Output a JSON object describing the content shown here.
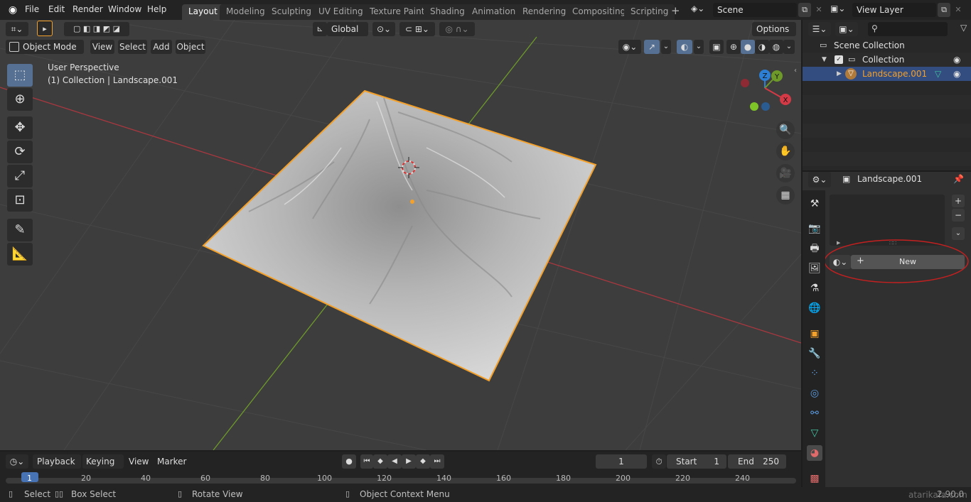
{
  "topbar": {
    "menus": [
      "File",
      "Edit",
      "Render",
      "Window",
      "Help"
    ],
    "workspace_tabs": [
      "Layout",
      "Modeling",
      "Sculpting",
      "UV Editing",
      "Texture Paint",
      "Shading",
      "Animation",
      "Rendering",
      "Compositing",
      "Scripting"
    ],
    "active_tab": "Layout",
    "scene": "Scene",
    "view_layer": "View Layer"
  },
  "viewport_header": {
    "transform_orientation": "Global",
    "options": "Options",
    "mode": "Object Mode",
    "menus": [
      "View",
      "Select",
      "Add",
      "Object"
    ]
  },
  "viewport": {
    "perspective_label": "User Perspective",
    "context_label": "(1) Collection | Landscape.001",
    "gizmo_axes": {
      "x": "X",
      "y": "Y",
      "z": "Z"
    },
    "colors": {
      "background": "#3d3d3d",
      "x_axis": "#a8383f",
      "y_axis": "#6e9a2a",
      "selection_outline": "#f4a12b",
      "terrain": "#c4c4c4"
    }
  },
  "toolbar": {
    "tools": [
      "select-box-icon",
      "cursor-icon",
      "move-icon",
      "rotate-icon",
      "scale-icon",
      "transform-icon",
      "annotate-icon",
      "measure-icon"
    ]
  },
  "outliner": {
    "search_placeholder": "",
    "scene_collection": "Scene Collection",
    "collection": "Collection",
    "object": "Landscape.001"
  },
  "properties": {
    "object_name": "Landscape.001",
    "new_button": "New"
  },
  "timeline": {
    "menus": [
      "Playback",
      "Keying",
      "View",
      "Marker"
    ],
    "current_frame": "1",
    "start_label": "Start",
    "start_value": "1",
    "end_label": "End",
    "end_value": "250",
    "ticks": [
      "1",
      "20",
      "40",
      "60",
      "80",
      "100",
      "120",
      "140",
      "160",
      "180",
      "200",
      "220",
      "240"
    ]
  },
  "statusbar": {
    "select": "Select",
    "box_select": "Box Select",
    "rotate_view": "Rotate View",
    "context_menu": "Object Context Menu",
    "version": "2.90.0",
    "watermark": "atarikafa.com"
  }
}
